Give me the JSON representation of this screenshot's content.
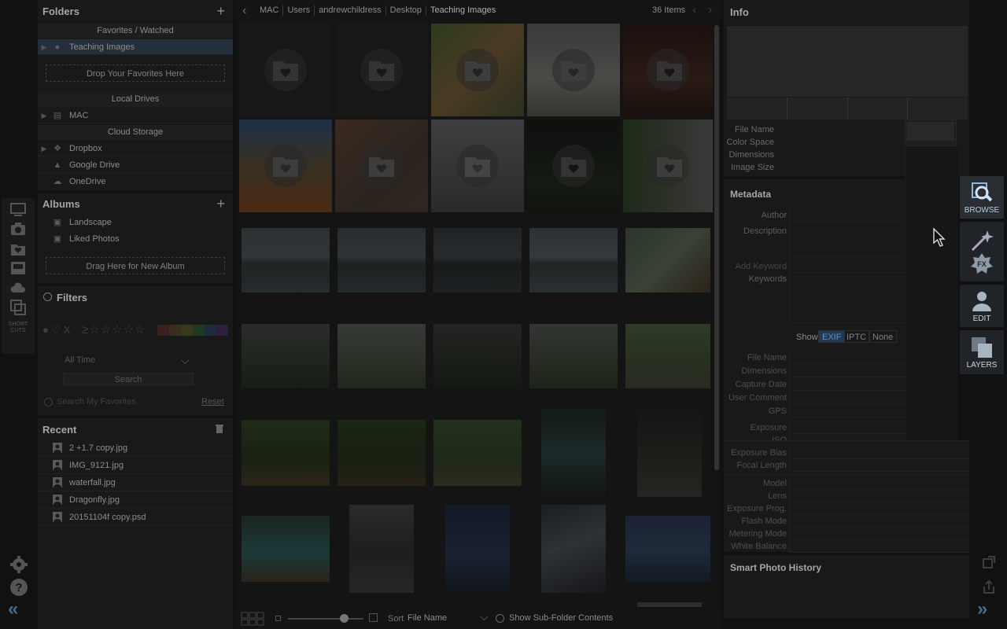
{
  "folders_panel": {
    "title": "Folders",
    "favorites_header": "Favorites / Watched",
    "favorite_items": [
      {
        "label": "Teaching Images"
      }
    ],
    "drop_favorites": "Drop Your Favorites Here",
    "local_drives_header": "Local Drives",
    "local_drives": [
      {
        "label": "MAC"
      }
    ],
    "cloud_header": "Cloud Storage",
    "cloud_items": [
      {
        "label": "Dropbox"
      },
      {
        "label": "Google Drive"
      },
      {
        "label": "OneDrive"
      }
    ]
  },
  "albums_panel": {
    "title": "Albums",
    "items": [
      {
        "label": "Landscape"
      },
      {
        "label": "Liked Photos"
      }
    ],
    "drop_album": "Drag Here for New Album"
  },
  "filters_panel": {
    "title": "Filters",
    "time_select": "All Time",
    "search_button": "Search",
    "search_favorites": "Search My Favorites",
    "reset": "Reset"
  },
  "recent_panel": {
    "title": "Recent",
    "items": [
      {
        "label": "2 +1.7 copy.jpg"
      },
      {
        "label": "IMG_9121.jpg"
      },
      {
        "label": "waterfall.jpg"
      },
      {
        "label": "Dragonfly.jpg"
      },
      {
        "label": "20151104f copy.psd"
      }
    ]
  },
  "left_strip": {
    "shortcuts_label": "SHORT CUTS"
  },
  "breadcrumb": {
    "items": [
      "MAC",
      "Users",
      "andrewchildress",
      "Desktop",
      "Teaching Images"
    ],
    "count": "36 Items"
  },
  "bottom_bar": {
    "sort_label": "Sort",
    "sort_value": "File Name",
    "subfolder": "Show Sub-Folder Contents"
  },
  "info_panel": {
    "title": "Info",
    "file_fields": [
      "File Name",
      "Color Space",
      "Dimensions",
      "Image Size"
    ],
    "metadata_title": "Metadata",
    "meta_fields": [
      "Author",
      "Description",
      "Add Keyword",
      "Keywords"
    ],
    "show_label": "Show",
    "show_tabs": [
      "EXIF",
      "IPTC",
      "None"
    ],
    "exif_group1": [
      "File Name",
      "Dimensions",
      "Capture Date",
      "User Comment",
      "GPS"
    ],
    "exif_group2": [
      "Exposure",
      "ISO",
      "Exposure Bias",
      "Focal Length"
    ],
    "exif_group3": [
      "Model",
      "Lens",
      "Exposure Prog.",
      "Flash Mode",
      "Metering Mode",
      "White Balance"
    ],
    "history_title": "Smart Photo History"
  },
  "module_buttons": [
    {
      "label": "BROWSE",
      "icon": "browse-icon"
    },
    {
      "label": "",
      "icon": "effects-wand-icon"
    },
    {
      "label": "EDIT",
      "icon": "portrait-icon"
    },
    {
      "label": "LAYERS",
      "icon": "layers-icon"
    }
  ],
  "colors": {
    "accent": "#3a8fd6",
    "selected": "#4a6d8c",
    "bg": "#111111"
  }
}
